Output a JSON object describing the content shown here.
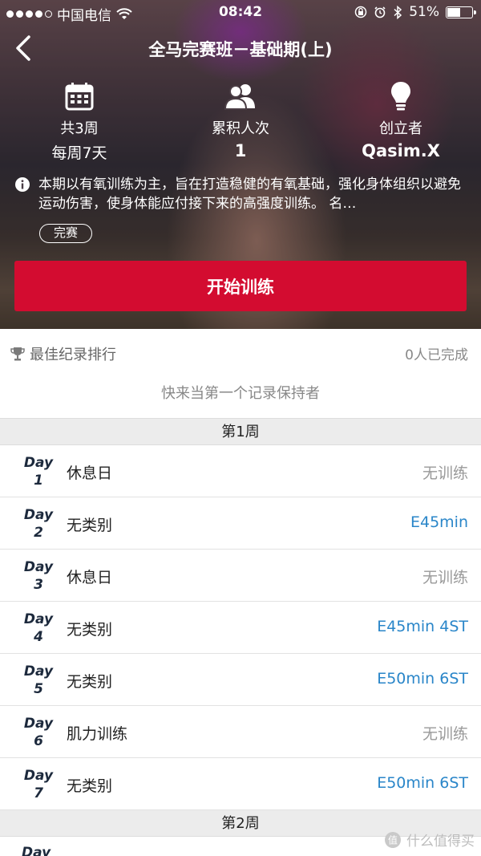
{
  "status_bar": {
    "carrier": "中国电信",
    "time": "08:42",
    "battery": "51%",
    "battery_level": 0.51
  },
  "nav": {
    "title": "全马完赛班－基础期(上)"
  },
  "stats": {
    "duration_line1": "共3周",
    "duration_line2": "每周7天",
    "participants_label": "累积人次",
    "participants_value": "1",
    "creator_label": "创立者",
    "creator_value": "Qasim.X"
  },
  "description": "本期以有氧训练为主，旨在打造稳健的有氧基础，强化身体组织以避免运动伤害，使身体能应付接下来的高强度训练。 名…",
  "tag": "完赛",
  "start_button": "开始训练",
  "leaderboard": {
    "title": "最佳纪录排行",
    "completed": "0人已完成",
    "empty_text": "快来当第一个记录保持者"
  },
  "schedule": {
    "day_word": "Day",
    "weeks": [
      {
        "label": "第1周",
        "days": [
          {
            "num": "1",
            "type": "休息日",
            "plan": "无训练",
            "color": "#999999"
          },
          {
            "num": "2",
            "type": "无类别",
            "plan": "E45min",
            "color": "#2a86c9"
          },
          {
            "num": "3",
            "type": "休息日",
            "plan": "无训练",
            "color": "#999999"
          },
          {
            "num": "4",
            "type": "无类别",
            "plan": "E45min 4ST",
            "color": "#2a86c9"
          },
          {
            "num": "5",
            "type": "无类别",
            "plan": "E50min 6ST",
            "color": "#2a86c9"
          },
          {
            "num": "6",
            "type": "肌力训练",
            "plan": "无训练",
            "color": "#999999"
          },
          {
            "num": "7",
            "type": "无类别",
            "plan": "E50min 6ST",
            "color": "#2a86c9"
          }
        ]
      },
      {
        "label": "第2周"
      }
    ]
  },
  "watermark": "什么值得买",
  "colors": {
    "accent_red": "#d30c30",
    "link_blue": "#2a86c9",
    "muted_gray": "#999999"
  }
}
